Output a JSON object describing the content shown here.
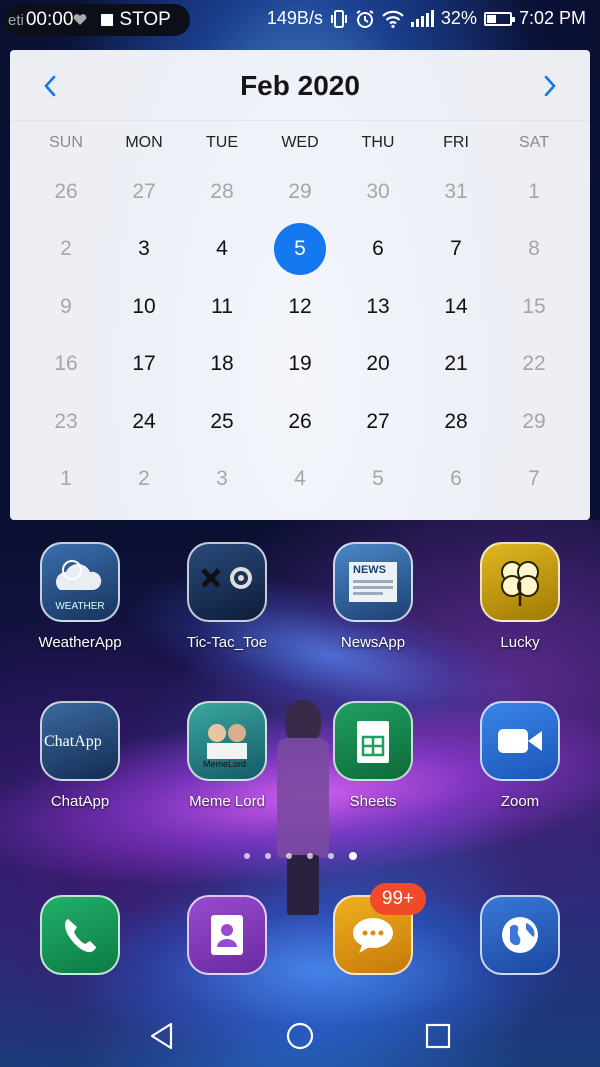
{
  "status_bar": {
    "recorder_faded_text": "eti",
    "recorder_timer": "00:00",
    "recorder_stop": "STOP",
    "net_speed": "149B/s",
    "battery_percent": "32%",
    "time": "7:02 PM"
  },
  "calendar": {
    "title": "Feb 2020",
    "weekdays": [
      "SUN",
      "MON",
      "TUE",
      "WED",
      "THU",
      "FRI",
      "SAT"
    ],
    "weeks": [
      [
        {
          "d": "26",
          "m": true
        },
        {
          "d": "27",
          "m": true
        },
        {
          "d": "28",
          "m": true
        },
        {
          "d": "29",
          "m": true
        },
        {
          "d": "30",
          "m": true
        },
        {
          "d": "31",
          "m": true
        },
        {
          "d": "1",
          "m": true
        }
      ],
      [
        {
          "d": "2",
          "m": true
        },
        {
          "d": "3"
        },
        {
          "d": "4"
        },
        {
          "d": "5",
          "sel": true
        },
        {
          "d": "6"
        },
        {
          "d": "7"
        },
        {
          "d": "8",
          "m": true
        }
      ],
      [
        {
          "d": "9",
          "m": true
        },
        {
          "d": "10"
        },
        {
          "d": "11"
        },
        {
          "d": "12"
        },
        {
          "d": "13"
        },
        {
          "d": "14"
        },
        {
          "d": "15",
          "m": true
        }
      ],
      [
        {
          "d": "16",
          "m": true
        },
        {
          "d": "17"
        },
        {
          "d": "18"
        },
        {
          "d": "19"
        },
        {
          "d": "20"
        },
        {
          "d": "21"
        },
        {
          "d": "22",
          "m": true
        }
      ],
      [
        {
          "d": "23",
          "m": true
        },
        {
          "d": "24"
        },
        {
          "d": "25"
        },
        {
          "d": "26"
        },
        {
          "d": "27"
        },
        {
          "d": "28"
        },
        {
          "d": "29",
          "m": true
        }
      ],
      [
        {
          "d": "1",
          "m": true
        },
        {
          "d": "2",
          "m": true
        },
        {
          "d": "3",
          "m": true
        },
        {
          "d": "4",
          "m": true
        },
        {
          "d": "5",
          "m": true
        },
        {
          "d": "6",
          "m": true
        },
        {
          "d": "7",
          "m": true
        }
      ]
    ]
  },
  "apps_row1": [
    {
      "label": "WeatherApp",
      "icon": "weather-icon"
    },
    {
      "label": "Tic-Tac_Toe",
      "icon": "tic-tac-toe-icon"
    },
    {
      "label": "NewsApp",
      "icon": "newspaper-icon"
    },
    {
      "label": "Lucky",
      "icon": "clover-icon"
    }
  ],
  "apps_row2": [
    {
      "label": "ChatApp",
      "icon": "chat-icon"
    },
    {
      "label": "Meme Lord",
      "icon": "meme-icon"
    },
    {
      "label": "Sheets",
      "icon": "spreadsheet-icon"
    },
    {
      "label": "Zoom",
      "icon": "video-camera-icon"
    }
  ],
  "icon_text": {
    "weather": "WEATHER",
    "chatapp": "ChatApp",
    "news": "NEWS",
    "meme": "MemeLord"
  },
  "dock": {
    "items": [
      "phone-icon",
      "contacts-icon",
      "messages-icon",
      "browser-globe-icon"
    ],
    "messages_badge": "99+"
  },
  "pager": {
    "pages": 6,
    "active_index": 5
  },
  "nav": [
    "back-icon",
    "home-icon",
    "recents-icon"
  ]
}
